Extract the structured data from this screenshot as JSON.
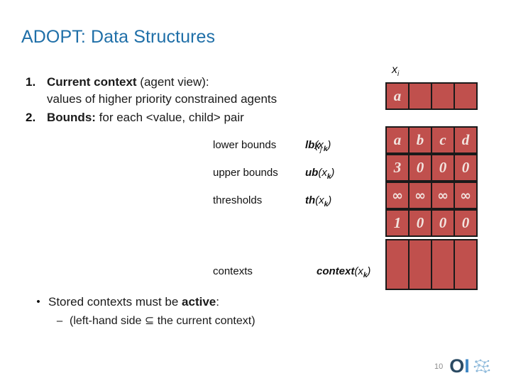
{
  "slide": {
    "title": "ADOPT: Data Structures",
    "title_color": "#1F6FA8",
    "page_number": "10"
  },
  "numbered_list": [
    {
      "marker": "1.",
      "bold_lead": "Current context",
      "rest": " (agent view):",
      "second_line": "values of higher priority constrained agents"
    },
    {
      "marker": "2.",
      "bold_lead": "Bounds:",
      "rest": " for each <value, child> pair",
      "second_line": ""
    }
  ],
  "bounds_table": {
    "var_label": "x",
    "var_sub": "j",
    "rows": [
      {
        "name": "lower bounds",
        "math_fn": "lb",
        "math_arg": "(x",
        "math_sub": "k",
        "math_close": ")"
      },
      {
        "name": "upper bounds",
        "math_fn": "ub",
        "math_arg": "(x",
        "math_sub": "k",
        "math_close": ")"
      },
      {
        "name": "thresholds",
        "math_fn": "th",
        "math_arg": "(x",
        "math_sub": "k",
        "math_close": ")"
      }
    ],
    "contexts_row": {
      "name": "contexts",
      "math_fn": "context",
      "math_arg": "(x",
      "math_sub": "k",
      "math_close": ")"
    }
  },
  "arrays": {
    "cell_fill": "#C0504D",
    "cell_border": "#1a1a1a",
    "cell_text_color": "#F2E4DF",
    "context_var_label": "x",
    "context_var_sub": "i",
    "context_array": {
      "name": "current-context",
      "cells": [
        "a",
        "",
        "",
        ""
      ]
    },
    "values_array": {
      "name": "values",
      "cells": [
        "a",
        "b",
        "c",
        "d"
      ]
    },
    "lb_array": {
      "name": "lower-bounds",
      "cells": [
        "3",
        "0",
        "0",
        "0"
      ]
    },
    "ub_array": {
      "name": "upper-bounds",
      "cells": [
        "∞",
        "∞",
        "∞",
        "∞"
      ]
    },
    "th_array": {
      "name": "thresholds",
      "cells": [
        "1",
        "0",
        "0",
        "0"
      ]
    },
    "contexts_array": {
      "name": "contexts",
      "cells": [
        "",
        "",
        "",
        ""
      ]
    }
  },
  "bottom_bullets": {
    "main_marker": "•",
    "main_lead": "Stored contexts must be ",
    "main_bold": "active",
    "main_tail": ":",
    "sub_marker": "–",
    "sub_text": "(left-hand side ⊆ the current context)"
  },
  "faint_text": ""
}
